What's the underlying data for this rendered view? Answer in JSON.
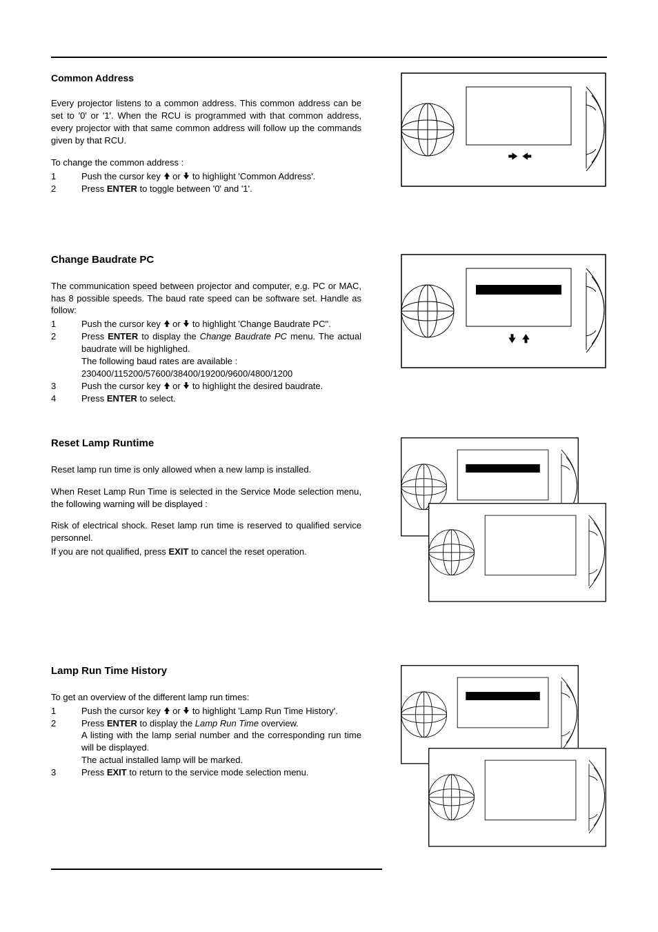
{
  "sections": {
    "common_address": {
      "title": "Common Address",
      "p1": "Every projector listens to a common address.  This common address can be set to '0' or '1'.  When the RCU is programmed with that common address, every projector with that same common address will follow up the commands given by that RCU.",
      "p2": "To change the common address :",
      "steps": [
        {
          "n": "1",
          "before": "Push the cursor key ",
          "mid": " or ",
          "after": " to highlight 'Common Address'."
        },
        {
          "n": "2",
          "plain_before": "Press ",
          "bold": "ENTER",
          "plain_after": " to toggle between '0' and '1'."
        }
      ]
    },
    "change_baud": {
      "title": "Change Baudrate PC",
      "p1": "The communication speed between projector and computer, e.g. PC or MAC, has 8 possible speeds.  The baud rate speed can be software set.  Handle as follow:",
      "steps": [
        {
          "n": "1",
          "before": "Push the cursor key ",
          "mid": " or ",
          "after": " to highlight 'Change Baudrate PC\"."
        },
        {
          "n": "2",
          "plain_before": "Press ",
          "bold": "ENTER",
          "plain_after_a": " to display the ",
          "italic": "Change Baudrate PC",
          "plain_after_b": " menu.  The actual baudrate will be highlighed.",
          "extra1": "The following baud rates are available :",
          "extra2": "230400/115200/57600/38400/19200/9600/4800/1200"
        },
        {
          "n": "3",
          "before": "Push the cursor key ",
          "mid": " or ",
          "after": " to highlight the desired baudrate."
        },
        {
          "n": "4",
          "plain_before": "Press ",
          "bold": "ENTER",
          "plain_after": " to select."
        }
      ]
    },
    "reset_lamp": {
      "title": "Reset Lamp Runtime",
      "p1": "Reset lamp run time is only allowed when a new lamp is installed.",
      "p2": "When Reset Lamp Run Time is selected in the Service Mode selection menu, the following warning will be displayed :",
      "p3": "Risk of electrical shock.  Reset lamp run time is reserved to qualified service  personnel.",
      "p4_before": "If you are not qualified, press ",
      "p4_bold": "EXIT",
      "p4_after": " to cancel the reset operation."
    },
    "lamp_history": {
      "title": "Lamp Run Time History",
      "p1": "To get an overview of the different lamp run times:",
      "steps": [
        {
          "n": "1",
          "before": "Push the cursor key ",
          "mid": " or ",
          "after": " to highlight 'Lamp Run Time History'."
        },
        {
          "n": "2",
          "plain_before": "Press ",
          "bold": "ENTER",
          "plain_after_a": " to display the ",
          "italic": "Lamp Run Time",
          "plain_after_b": " overview.",
          "extra1": "A listing with the lamp serial number and the corresponding run time will be displayed.",
          "extra2": "The actual installed lamp will be marked."
        },
        {
          "n": "3",
          "plain_before": "Press ",
          "bold": "EXIT",
          "plain_after": " to return to the service mode selection menu."
        }
      ]
    }
  }
}
